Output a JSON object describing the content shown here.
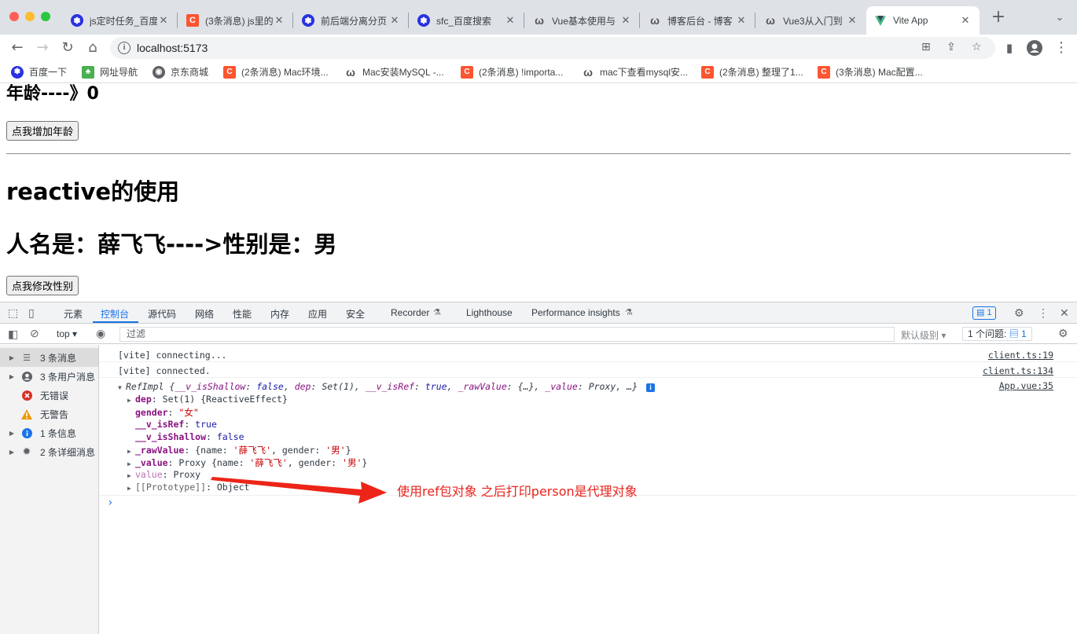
{
  "browser": {
    "tabs": [
      {
        "title": "js定时任务_百度",
        "icon": "baidu-paw-icon"
      },
      {
        "title": "(3条消息) js里的",
        "icon": "csdn-icon"
      },
      {
        "title": "前后端分离分页",
        "icon": "baidu-paw-icon"
      },
      {
        "title": "sfc_百度搜索",
        "icon": "baidu-paw-icon"
      },
      {
        "title": "Vue基本使用与",
        "icon": "blog-icon"
      },
      {
        "title": "博客后台 - 博客",
        "icon": "blog-icon"
      },
      {
        "title": "Vue3从入门到",
        "icon": "blog-icon"
      },
      {
        "title": "Vite App",
        "icon": "vite-icon",
        "active": true
      }
    ],
    "address": {
      "url": "localhost:5173"
    },
    "bookmarks": [
      {
        "label": "百度一下",
        "icon": "baidu-paw-icon"
      },
      {
        "label": "网址导航",
        "icon": "hao123-icon"
      },
      {
        "label": "京东商城",
        "icon": "globe-icon"
      },
      {
        "label": "(2条消息) Mac环境...",
        "icon": "csdn-icon"
      },
      {
        "label": "Mac安装MySQL -...",
        "icon": "blog-icon"
      },
      {
        "label": "(2条消息) !importa...",
        "icon": "csdn-icon"
      },
      {
        "label": "mac下查看mysql安...",
        "icon": "blog-icon"
      },
      {
        "label": "(2条消息) 整理了1...",
        "icon": "csdn-icon"
      },
      {
        "label": "(3条消息) Mac配置...",
        "icon": "csdn-icon"
      }
    ]
  },
  "page": {
    "age_heading": "年龄----》0",
    "add_age_button": "点我增加年龄",
    "reactive_heading": "reactive的使用",
    "person_heading": "人名是：薛飞飞---->性别是：男",
    "change_gender_button": "点我修改性别"
  },
  "devtools": {
    "tabs": [
      "元素",
      "控制台",
      "源代码",
      "网络",
      "性能",
      "内存",
      "应用",
      "安全",
      "Recorder",
      "Lighthouse",
      "Performance insights"
    ],
    "active_tab": "控制台",
    "message_badge": "1",
    "context": "top",
    "filter_placeholder": "过滤",
    "levels": "默认级别",
    "issues_label": "1 个问题:",
    "issues_count": "1",
    "sidebar": [
      {
        "label": "3 条消息",
        "icon": "list-icon",
        "expandable": true,
        "selected": true
      },
      {
        "label": "3 条用户消息",
        "icon": "user-icon",
        "expandable": true
      },
      {
        "label": "无错误",
        "icon": "error-icon",
        "expandable": false
      },
      {
        "label": "无警告",
        "icon": "warning-icon",
        "expandable": false
      },
      {
        "label": "1 条信息",
        "icon": "info-icon",
        "expandable": true
      },
      {
        "label": "2 条详细消息",
        "icon": "bug-icon",
        "expandable": true
      }
    ],
    "console": {
      "line1": {
        "text": "[vite] connecting...",
        "source": "client.ts:19"
      },
      "line2": {
        "text": "[vite] connected.",
        "source": "client.ts:134"
      },
      "obj": {
        "source": "App.vue:35",
        "summary_class": "RefImpl ",
        "summary_open": "{",
        "summary_k1": "__v_isShallow",
        "summary_v1": "false",
        "summary_k2": "dep",
        "summary_v2": "Set(1)",
        "summary_k3": "__v_isRef",
        "summary_v3": "true",
        "summary_k4": "_rawValue",
        "summary_v4": "{…}",
        "summary_k5": "_value",
        "summary_v5": "Proxy",
        "summary_close": ", …}",
        "dep_key": "dep",
        "dep_val": "Set(1) {ReactiveEffect}",
        "gender_key": "gender",
        "gender_val": "\"女\"",
        "isref_key": "__v_isRef",
        "isref_val": "true",
        "shallow_key": "__v_isShallow",
        "shallow_val": "false",
        "raw_key": "_rawValue",
        "raw_val_pre": "{name: ",
        "raw_name": "'薛飞飞'",
        "raw_mid": ", gender: ",
        "raw_gender": "'男'",
        "raw_end": "}",
        "value_key": "_value",
        "value_pre": "Proxy {name: ",
        "value_name": "'薛飞飞'",
        "value_mid": ", gender: ",
        "value_gender": "'男'",
        "value_end": "}",
        "getter_key": "value",
        "getter_val": "Proxy",
        "proto_key": "[[Prototype]]",
        "proto_val": "Object"
      },
      "prompt": "›"
    }
  },
  "annotation": {
    "text": "使用ref包对象 之后打印person是代理对象",
    "color": "#e8231c"
  }
}
